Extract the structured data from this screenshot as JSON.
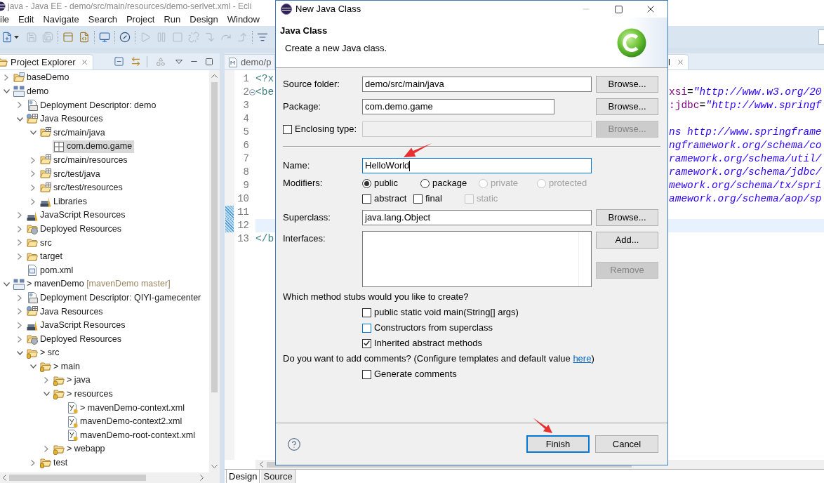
{
  "window": {
    "title": "java - Java EE - demo/src/main/resources/demo-serlvet.xml - Ecli"
  },
  "menu": [
    "ile",
    "Edit",
    "Navigate",
    "Search",
    "Project",
    "Run",
    "Design",
    "Window"
  ],
  "toolbar": [
    {
      "items": [
        {
          "kind": "new-file",
          "disabled": false
        },
        {
          "kind": "caret",
          "disabled": false
        },
        {
          "kind": "save",
          "disabled": true
        },
        {
          "kind": "save-all",
          "disabled": true
        }
      ]
    },
    {
      "items": [
        {
          "kind": "panel",
          "disabled": false
        },
        {
          "kind": "file-code",
          "disabled": false
        }
      ]
    },
    {
      "items": [
        {
          "kind": "monitor",
          "disabled": false
        }
      ]
    },
    {
      "items": [
        {
          "kind": "slashed-circle",
          "disabled": false
        }
      ]
    },
    {
      "items": [
        {
          "kind": "play",
          "disabled": true
        },
        {
          "kind": "pause",
          "disabled": true
        },
        {
          "kind": "stop",
          "disabled": true
        },
        {
          "kind": "unlink",
          "disabled": true
        },
        {
          "kind": "step-into",
          "disabled": true
        },
        {
          "kind": "step-over",
          "disabled": true
        },
        {
          "kind": "step-return",
          "disabled": true
        }
      ]
    },
    {
      "items": [
        {
          "kind": "filter",
          "disabled": false
        }
      ]
    }
  ],
  "explorer": {
    "tab": "Project Explorer",
    "tree": [
      {
        "label": "baseDemo",
        "kind": "project",
        "expanded": false,
        "selected": false
      },
      {
        "label": "demo",
        "kind": "web-project",
        "expanded": true,
        "selected": false,
        "children": [
          {
            "label": "Deployment Descriptor: demo",
            "kind": "descriptor",
            "expanded": false,
            "selected": false
          },
          {
            "label": "Java Resources",
            "kind": "java-resources",
            "expanded": true,
            "selected": false,
            "children": [
              {
                "label": "src/main/java",
                "kind": "source-folder",
                "expanded": true,
                "selected": false,
                "children": [
                  {
                    "label": "com.demo.game",
                    "kind": "package",
                    "selected": true
                  }
                ]
              },
              {
                "label": "src/main/resources",
                "kind": "source-folder",
                "expanded": false,
                "selected": false
              },
              {
                "label": "src/test/java",
                "kind": "source-folder",
                "expanded": false,
                "selected": false
              },
              {
                "label": "src/test/resources",
                "kind": "source-folder",
                "expanded": false,
                "selected": false
              },
              {
                "label": "Libraries",
                "kind": "library",
                "expanded": false,
                "selected": false
              }
            ]
          },
          {
            "label": "JavaScript Resources",
            "kind": "js-resources",
            "expanded": false,
            "selected": false
          },
          {
            "label": "Deployed Resources",
            "kind": "deployed",
            "expanded": false,
            "selected": false
          },
          {
            "label": "src",
            "kind": "folder",
            "expanded": false,
            "selected": false
          },
          {
            "label": "target",
            "kind": "folder",
            "expanded": false,
            "selected": false
          },
          {
            "label": "pom.xml",
            "kind": "pom",
            "selected": false
          }
        ]
      },
      {
        "label": "> mavenDemo",
        "decoration": "[mavenDemo master]",
        "kind": "web-project",
        "expanded": true,
        "selected": false,
        "children": [
          {
            "label": "Deployment Descriptor: QIYI-gamecenter",
            "kind": "descriptor",
            "expanded": false,
            "selected": false
          },
          {
            "label": "Java Resources",
            "kind": "java-resources",
            "expanded": false,
            "selected": false
          },
          {
            "label": "JavaScript Resources",
            "kind": "js-resources",
            "expanded": false,
            "selected": false
          },
          {
            "label": "Deployed Resources",
            "kind": "deployed",
            "expanded": false,
            "selected": false
          },
          {
            "label": "> src",
            "kind": "git-folder",
            "expanded": true,
            "selected": false,
            "children": [
              {
                "label": "> main",
                "kind": "git-folder",
                "expanded": true,
                "selected": false,
                "children": [
                  {
                    "label": "> java",
                    "kind": "git-folder",
                    "expanded": false,
                    "selected": false
                  },
                  {
                    "label": "> resources",
                    "kind": "git-folder",
                    "expanded": true,
                    "selected": false,
                    "children": [
                      {
                        "label": "> mavenDemo-context.xml",
                        "kind": "xml-file",
                        "selected": false
                      },
                      {
                        "label": "mavenDemo-context2.xml",
                        "kind": "xml-file",
                        "selected": false
                      },
                      {
                        "label": "mavenDemo-root-context.xml",
                        "kind": "xml-file",
                        "selected": false
                      }
                    ]
                  },
                  {
                    "label": "> webapp",
                    "kind": "git-folder",
                    "expanded": false,
                    "selected": false
                  }
                ]
              },
              {
                "label": "test",
                "kind": "git-folder",
                "expanded": false,
                "selected": false
              }
            ]
          }
        ]
      }
    ]
  },
  "editor": {
    "tabs": [
      {
        "label": "demo/p",
        "selected": false
      },
      {
        "label": "l",
        "selected": true
      }
    ],
    "lines": [
      {
        "number": "1",
        "left": [
          {
            "text": "<?x",
            "kind": "tag"
          }
        ],
        "changed": false,
        "current": false,
        "fold": false
      },
      {
        "number": "2",
        "left": [
          {
            "text": "<be",
            "kind": "tag"
          }
        ],
        "right": [
          {
            "text": "xsi",
            "kind": "attribute"
          },
          {
            "text": "=",
            "kind": "plain"
          },
          {
            "text": "\"http://www.w3.org/20",
            "kind": "string"
          }
        ],
        "changed": false,
        "current": false,
        "fold": true
      },
      {
        "number": "3",
        "right": [
          {
            "text": ":jdbc",
            "kind": "attribute"
          },
          {
            "text": "=",
            "kind": "plain"
          },
          {
            "text": "\"http://www.springf",
            "kind": "string"
          }
        ],
        "changed": false,
        "current": false,
        "fold": false
      },
      {
        "number": "4",
        "changed": false,
        "current": false,
        "fold": false
      },
      {
        "number": "5",
        "right": [
          {
            "text": "ns http://www.springframe",
            "kind": "string"
          }
        ],
        "changed": false,
        "current": false,
        "fold": false
      },
      {
        "number": "6",
        "right": [
          {
            "text": "ngframework.org/schema/co",
            "kind": "string"
          }
        ],
        "changed": false,
        "current": false,
        "fold": false
      },
      {
        "number": "7",
        "right": [
          {
            "text": "ramework.org/schema/util/",
            "kind": "string"
          }
        ],
        "changed": false,
        "current": false,
        "fold": false
      },
      {
        "number": "8",
        "right": [
          {
            "text": "ramework.org/schema/jdbc/",
            "kind": "string"
          }
        ],
        "changed": false,
        "current": false,
        "fold": false
      },
      {
        "number": "9",
        "right": [
          {
            "text": "mework.org/schema/tx/spri",
            "kind": "string"
          }
        ],
        "changed": false,
        "current": false,
        "fold": false
      },
      {
        "number": "10",
        "right": [
          {
            "text": "amework.org/schema/aop/sp",
            "kind": "string"
          }
        ],
        "changed": false,
        "current": false,
        "fold": false
      },
      {
        "number": "11",
        "changed": true,
        "current": false,
        "fold": false
      },
      {
        "number": "12",
        "changed": true,
        "current": true,
        "fold": false
      },
      {
        "number": "13",
        "left": [
          {
            "text": "</b",
            "kind": "tag"
          }
        ],
        "changed": false,
        "current": false,
        "fold": false
      }
    ],
    "bottom_tabs": [
      {
        "label": "Design",
        "selected": true
      },
      {
        "label": "Source",
        "selected": false
      }
    ]
  },
  "dialog": {
    "title": "New Java Class",
    "heading": "Java Class",
    "description": "Create a new Java class.",
    "source_folder": {
      "label": "Source folder:",
      "value": "demo/src/main/java",
      "button": {
        "label": "Browse...",
        "disabled": false
      }
    },
    "package": {
      "label": "Package:",
      "value": "com.demo.game",
      "button": {
        "label": "Browse...",
        "disabled": false
      }
    },
    "enclosing_type": {
      "label": "Enclosing type:",
      "checked": false,
      "disabled": true,
      "button": {
        "label": "Browse...",
        "disabled": true
      }
    },
    "name": {
      "label": "Name:",
      "value": "HelloWorld",
      "focused": true
    },
    "modifiers": {
      "label": "Modifiers:",
      "access": [
        {
          "label": "public",
          "selected": true,
          "disabled": false
        },
        {
          "label": "package",
          "selected": false,
          "disabled": false
        },
        {
          "label": "private",
          "selected": false,
          "disabled": true
        },
        {
          "label": "protected",
          "selected": false,
          "disabled": true
        }
      ],
      "flags": [
        {
          "label": "abstract",
          "checked": false,
          "disabled": false
        },
        {
          "label": "final",
          "checked": false,
          "disabled": false
        },
        {
          "label": "static",
          "checked": false,
          "disabled": true
        }
      ]
    },
    "superclass": {
      "label": "Superclass:",
      "value": "java.lang.Object",
      "button": {
        "label": "Browse...",
        "disabled": false
      }
    },
    "interfaces": {
      "label": "Interfaces:",
      "buttons": [
        {
          "label": "Add...",
          "disabled": false
        },
        {
          "label": "Remove",
          "disabled": true
        }
      ]
    },
    "stubs": {
      "question": "Which method stubs would you like to create?",
      "options": [
        {
          "label": "public static void main(String[] args)",
          "checked": false,
          "hovered": false
        },
        {
          "label": "Constructors from superclass",
          "checked": false,
          "hovered": true
        },
        {
          "label": "Inherited abstract methods",
          "checked": true,
          "hovered": false
        }
      ]
    },
    "comments": {
      "question": "Do you want to add comments? (Configure templates and default value",
      "link": "here",
      "closing": ")",
      "options": [
        {
          "label": "Generate comments",
          "checked": false,
          "hovered": false
        }
      ]
    },
    "buttons": [
      {
        "label": "Finish",
        "default": true
      },
      {
        "label": "Cancel",
        "default": false
      }
    ]
  }
}
